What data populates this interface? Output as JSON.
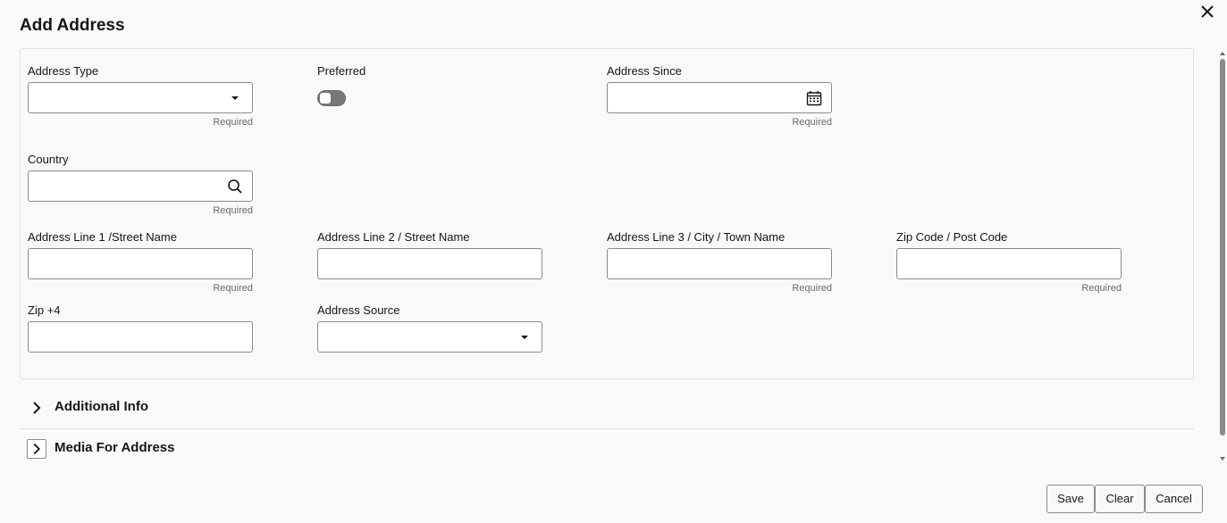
{
  "dialog": {
    "title": "Add Address"
  },
  "fields": {
    "address_type": {
      "label": "Address Type",
      "value": "",
      "hint": "Required"
    },
    "preferred": {
      "label": "Preferred",
      "checked": false
    },
    "address_since": {
      "label": "Address Since",
      "value": "",
      "hint": "Required"
    },
    "country": {
      "label": "Country",
      "value": "",
      "hint": "Required"
    },
    "line1": {
      "label": "Address Line 1 /Street Name",
      "value": "",
      "hint": "Required"
    },
    "line2": {
      "label": "Address Line 2 / Street Name",
      "value": ""
    },
    "line3": {
      "label": "Address Line 3 / City / Town Name",
      "value": "",
      "hint": "Required"
    },
    "zip": {
      "label": "Zip Code / Post Code",
      "value": "",
      "hint": "Required"
    },
    "zip4": {
      "label": "Zip +4",
      "value": ""
    },
    "address_source": {
      "label": "Address Source",
      "value": ""
    }
  },
  "sections": [
    {
      "title": "Additional Info",
      "icon": "chevron-right-icon"
    },
    {
      "title": "Media For Address",
      "icon": "chevron-right-icon"
    }
  ],
  "actions": {
    "save": "Save",
    "clear": "Clear",
    "cancel": "Cancel"
  },
  "icons": {
    "close": "close-icon",
    "dropdown": "caret-down-icon",
    "calendar": "calendar-icon",
    "search": "search-icon"
  },
  "colors": {
    "background": "#fbf9f8",
    "border": "#8d8b88",
    "text": "#161513",
    "toggle_off": "#7a7774"
  }
}
